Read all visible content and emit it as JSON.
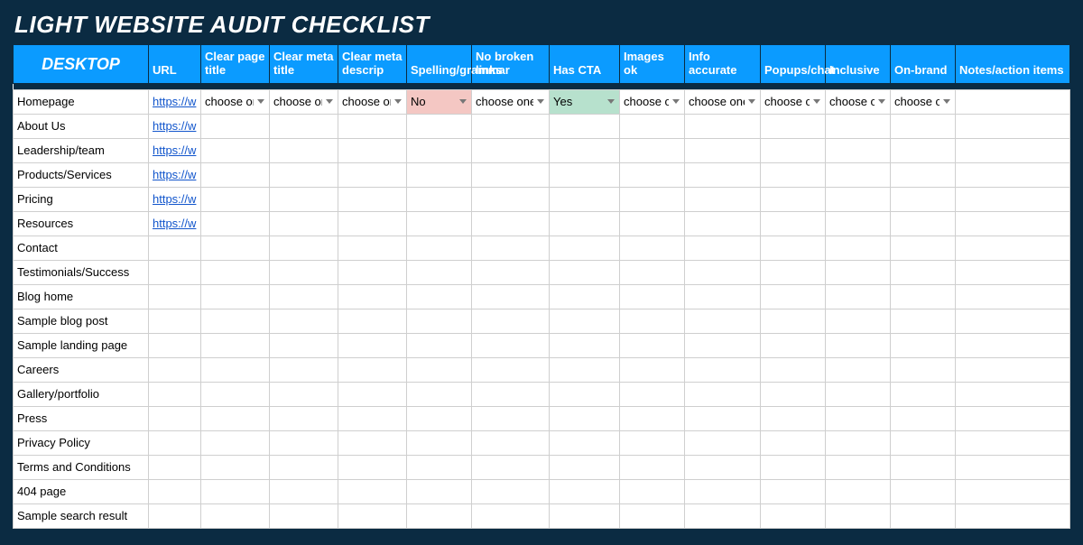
{
  "title": "LIGHT WEBSITE AUDIT CHECKLIST",
  "placeholder": "choose one",
  "values": {
    "no": "No",
    "yes": "Yes"
  },
  "columns": {
    "section": "DESKTOP",
    "url": "URL",
    "page_title": "Clear page title",
    "meta_title": "Clear meta title",
    "meta_descrip": "Clear meta descrip",
    "spelling": "Spelling/grammar",
    "no_broken": "No broken links",
    "has_cta": "Has CTA",
    "images_ok": "Images ok",
    "info_accurate": "Info accurate",
    "popups_chat": "Popups/chat",
    "inclusive": "Inclusive",
    "on_brand": "On-brand",
    "notes": "Notes/action items"
  },
  "rows": [
    {
      "label": "Homepage",
      "url": "https://w",
      "page_title": "placeholder",
      "meta_title": "placeholder",
      "meta_descrip": "placeholder",
      "spelling": "no",
      "no_broken": "placeholder",
      "has_cta": "yes",
      "images_ok": "placeholder",
      "info_accurate": "placeholder",
      "popups_chat": "placeholder",
      "inclusive": "placeholder",
      "on_brand": "placeholder"
    },
    {
      "label": "About Us",
      "url": "https://w"
    },
    {
      "label": "Leadership/team",
      "url": "https://w"
    },
    {
      "label": "Products/Services",
      "url": "https://w"
    },
    {
      "label": "Pricing",
      "url": "https://w"
    },
    {
      "label": "Resources",
      "url": "https://w"
    },
    {
      "label": "Contact"
    },
    {
      "label": "Testimonials/Success"
    },
    {
      "label": "Blog home"
    },
    {
      "label": "Sample blog post"
    },
    {
      "label": "Sample landing page"
    },
    {
      "label": "Careers"
    },
    {
      "label": "Gallery/portfolio"
    },
    {
      "label": "Press"
    },
    {
      "label": "Privacy Policy"
    },
    {
      "label": "Terms and Conditions"
    },
    {
      "label": "404 page"
    },
    {
      "label": "Sample search result"
    }
  ],
  "chart_data": {
    "type": "table",
    "title": "LIGHT WEBSITE AUDIT CHECKLIST",
    "columns": [
      "DESKTOP",
      "URL",
      "Clear page title",
      "Clear meta title",
      "Clear meta descrip",
      "Spelling/grammar",
      "No broken links",
      "Has CTA",
      "Images ok",
      "Info accurate",
      "Popups/chat",
      "Inclusive",
      "On-brand",
      "Notes/action items"
    ],
    "rows": [
      [
        "Homepage",
        "https://w",
        "choose one",
        "choose one",
        "choose one",
        "No",
        "choose one",
        "Yes",
        "choose one",
        "choose one",
        "choose one",
        "choose one",
        "choose one",
        ""
      ],
      [
        "About Us",
        "https://w",
        "",
        "",
        "",
        "",
        "",
        "",
        "",
        "",
        "",
        "",
        "",
        ""
      ],
      [
        "Leadership/team",
        "https://w",
        "",
        "",
        "",
        "",
        "",
        "",
        "",
        "",
        "",
        "",
        "",
        ""
      ],
      [
        "Products/Services",
        "https://w",
        "",
        "",
        "",
        "",
        "",
        "",
        "",
        "",
        "",
        "",
        "",
        ""
      ],
      [
        "Pricing",
        "https://w",
        "",
        "",
        "",
        "",
        "",
        "",
        "",
        "",
        "",
        "",
        "",
        ""
      ],
      [
        "Resources",
        "https://w",
        "",
        "",
        "",
        "",
        "",
        "",
        "",
        "",
        "",
        "",
        "",
        ""
      ],
      [
        "Contact",
        "",
        "",
        "",
        "",
        "",
        "",
        "",
        "",
        "",
        "",
        "",
        "",
        ""
      ],
      [
        "Testimonials/Success",
        "",
        "",
        "",
        "",
        "",
        "",
        "",
        "",
        "",
        "",
        "",
        "",
        ""
      ],
      [
        "Blog home",
        "",
        "",
        "",
        "",
        "",
        "",
        "",
        "",
        "",
        "",
        "",
        "",
        ""
      ],
      [
        "Sample blog post",
        "",
        "",
        "",
        "",
        "",
        "",
        "",
        "",
        "",
        "",
        "",
        "",
        ""
      ],
      [
        "Sample landing page",
        "",
        "",
        "",
        "",
        "",
        "",
        "",
        "",
        "",
        "",
        "",
        "",
        ""
      ],
      [
        "Careers",
        "",
        "",
        "",
        "",
        "",
        "",
        "",
        "",
        "",
        "",
        "",
        "",
        ""
      ],
      [
        "Gallery/portfolio",
        "",
        "",
        "",
        "",
        "",
        "",
        "",
        "",
        "",
        "",
        "",
        "",
        ""
      ],
      [
        "Press",
        "",
        "",
        "",
        "",
        "",
        "",
        "",
        "",
        "",
        "",
        "",
        "",
        ""
      ],
      [
        "Privacy Policy",
        "",
        "",
        "",
        "",
        "",
        "",
        "",
        "",
        "",
        "",
        "",
        "",
        ""
      ],
      [
        "Terms and Conditions",
        "",
        "",
        "",
        "",
        "",
        "",
        "",
        "",
        "",
        "",
        "",
        "",
        ""
      ],
      [
        "404 page",
        "",
        "",
        "",
        "",
        "",
        "",
        "",
        "",
        "",
        "",
        "",
        "",
        ""
      ],
      [
        "Sample search result",
        "",
        "",
        "",
        "",
        "",
        "",
        "",
        "",
        "",
        "",
        "",
        "",
        ""
      ]
    ]
  }
}
